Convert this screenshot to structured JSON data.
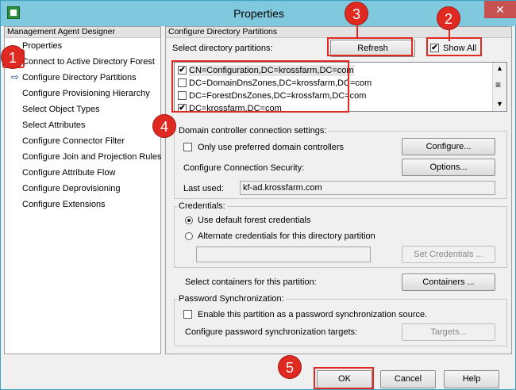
{
  "window": {
    "title": "Properties",
    "close_glyph": "✕"
  },
  "left": {
    "header": "Management Agent Designer",
    "items": [
      "Properties",
      "Connect to Active Directory Forest",
      "Configure Directory Partitions",
      "Configure Provisioning Hierarchy",
      "Select Object Types",
      "Select Attributes",
      "Configure Connector Filter",
      "Configure Join and Projection Rules",
      "Configure Attribute Flow",
      "Configure Deprovisioning",
      "Configure Extensions"
    ],
    "current_arrow": "⇨"
  },
  "right": {
    "header": "Configure Directory Partitions",
    "select_label": "Select directory partitions:",
    "refresh": "Refresh",
    "show_all": "Show All",
    "partitions": [
      {
        "label": "CN=Configuration,DC=krossfarm,DC=com",
        "checked": "✔"
      },
      {
        "label": "DC=DomainDnsZones,DC=krossfarm,DC=com",
        "checked": ""
      },
      {
        "label": "DC=ForestDnsZones,DC=krossfarm,DC=com",
        "checked": ""
      },
      {
        "label": "DC=krossfarm,DC=com",
        "checked": "✔"
      }
    ],
    "dc_group": {
      "legend": "Domain controller connection settings:",
      "only_preferred": "Only use preferred domain controllers",
      "configure": "Configure...",
      "security": "Configure Connection Security:",
      "options": "Options...",
      "last_used_label": "Last used:",
      "last_used_value": "kf-ad.krossfarm.com"
    },
    "cred_group": {
      "legend": "Credentials:",
      "default": "Use default forest credentials",
      "alternate": "Alternate credentials for this directory partition",
      "set_credentials": "Set Credentials ..."
    },
    "containers_label": "Select containers for this partition:",
    "containers": "Containers ...",
    "pwd_group": {
      "legend": "Password Synchronization:",
      "enable": "Enable this partition as a password synchronization source.",
      "targets_label": "Configure password synchronization targets:",
      "targets": "Targets..."
    }
  },
  "footer": {
    "ok": "OK",
    "cancel": "Cancel",
    "help": "Help"
  },
  "callouts": [
    "1",
    "2",
    "3",
    "4",
    "5"
  ]
}
